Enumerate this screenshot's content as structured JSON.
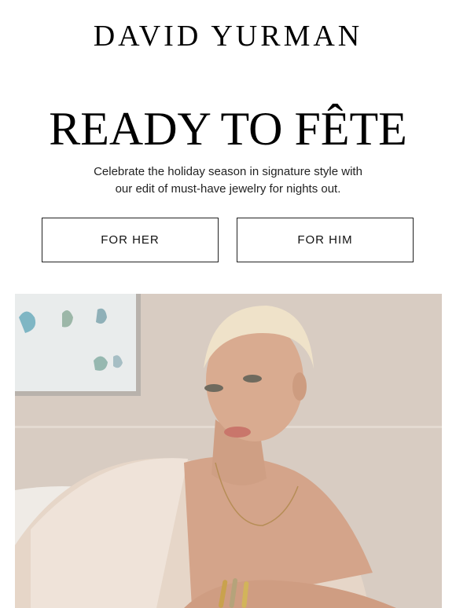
{
  "brand": {
    "logo_text": "DAVID YURMAN"
  },
  "hero_section": {
    "headline": "READY TO FÊTE",
    "subcopy_line1": "Celebrate the holiday season in signature style with",
    "subcopy_line2": "our edit of must-have jewelry for nights out."
  },
  "buttons": {
    "for_her": "FOR HER",
    "for_him": "FOR HIM"
  },
  "colors": {
    "text": "#000000",
    "background": "#ffffff",
    "button_border": "#222222"
  }
}
